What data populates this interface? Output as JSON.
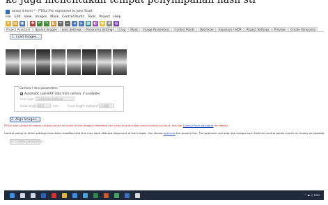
{
  "caption": {
    "text": "ke juga menentukan tempat penyimpanan hasil sti"
  },
  "window": {
    "title": "lantai 4.hsmi * - PTGui Pro registered to John Scott"
  },
  "menubar": {
    "items": [
      "File",
      "Edit",
      "View",
      "Images",
      "Mask",
      "Control Points",
      "Tools",
      "Project",
      "Help"
    ]
  },
  "toolbar": {
    "buttons": [
      {
        "icon": "new-project-icon",
        "color": "#e8b135"
      },
      {
        "icon": "open-icon",
        "color": "#d99a2b"
      },
      {
        "icon": "save-icon",
        "color": "#3a66b5"
      },
      {
        "icon": "cp-editor-icon",
        "color": "#b33d3d"
      },
      {
        "icon": "undo-icon",
        "color": "#3f8a3b"
      },
      {
        "icon": "redo-icon",
        "color": "#3f8a3b"
      },
      {
        "icon": "panorama-editor-icon",
        "color": "#d98a2a"
      },
      {
        "icon": "zoom-in-icon",
        "color": "#6a6a6a"
      },
      {
        "icon": "zoom-out-icon",
        "color": "#6a6a6a"
      },
      {
        "icon": "arrow-left-icon",
        "color": "#4a78c2"
      },
      {
        "icon": "arrow-right-icon",
        "color": "#4a78c2"
      },
      {
        "icon": "grid-icon",
        "color": "#2e8b8b"
      },
      {
        "icon": "mask-icon",
        "color": "#9c4ec0"
      },
      {
        "icon": "lightbulb-icon",
        "color": "#e3c32a"
      },
      {
        "icon": "num-icon",
        "color": "#8a8a8a"
      },
      {
        "icon": "globe-icon",
        "color": "#7b3bb3"
      }
    ]
  },
  "tabs": [
    "Project Assistant",
    "Source Images",
    "Lens Settings",
    "Panorama Settings",
    "Crop",
    "Mask",
    "Image Parameters",
    "Control Points",
    "Optimizer",
    "Exposure / HDR",
    "Project Settings",
    "Preview",
    "Create Panorama"
  ],
  "assistant": {
    "load_label": "1. Load Images...",
    "align_label": "2. Align Images...",
    "create_label": "3. Create panorama...",
    "thumbnail_count": 8,
    "camera": {
      "legend": "Camera / lens parameters",
      "exif_checked": true,
      "exif_label": "Automatic (use EXIF data from camera, if available)",
      "lens_type_label": "Lens type",
      "lens_type_value": "Full frame Fisheye",
      "focal_length_label": "Focal length",
      "focal_length_value": "10,5",
      "focal_length_unit": "mm",
      "multiplier_label": "Focal length multiplier",
      "multiplier_value": "1,000"
    },
    "warning": {
      "pre": "PTGui was unable to detect control points for some of the images; therefore you need to add a few control points by hand. See the ",
      "link": "Control Point Assistant",
      "post": " for details."
    },
    "info": {
      "pre": "Control points or other settings have been modified and this may have affected alignment of the images. You should ",
      "link": "optimize",
      "post": " the project first. The optimizer will align the images such that the control points match as closely as possible."
    }
  },
  "taskbar": {
    "icons": [
      {
        "icon": "windows-start-icon",
        "color": "#3a8ee6"
      },
      {
        "icon": "search-icon",
        "color": "#cfd6df"
      },
      {
        "icon": "task-view-icon",
        "color": "#cfd6df"
      },
      {
        "icon": "word-icon",
        "color": "#2b5fb8"
      },
      {
        "icon": "opera-icon",
        "color": "#d63232"
      },
      {
        "icon": "explorer-icon",
        "color": "#e2b437"
      },
      {
        "icon": "store-icon",
        "color": "#3a8ee6"
      },
      {
        "icon": "photos-icon",
        "color": "#4aa3d8"
      },
      {
        "icon": "excel-icon",
        "color": "#2f8a47"
      },
      {
        "icon": "powerpoint-icon",
        "color": "#d0542b"
      },
      {
        "icon": "chrome-icon",
        "color": "#40a460"
      },
      {
        "icon": "ptgui-icon",
        "color": "#3a6fc2"
      },
      {
        "icon": "app-icon",
        "color": "#d8d8d8"
      }
    ],
    "tray_text": "^ ⏏ ♫ ENG"
  }
}
